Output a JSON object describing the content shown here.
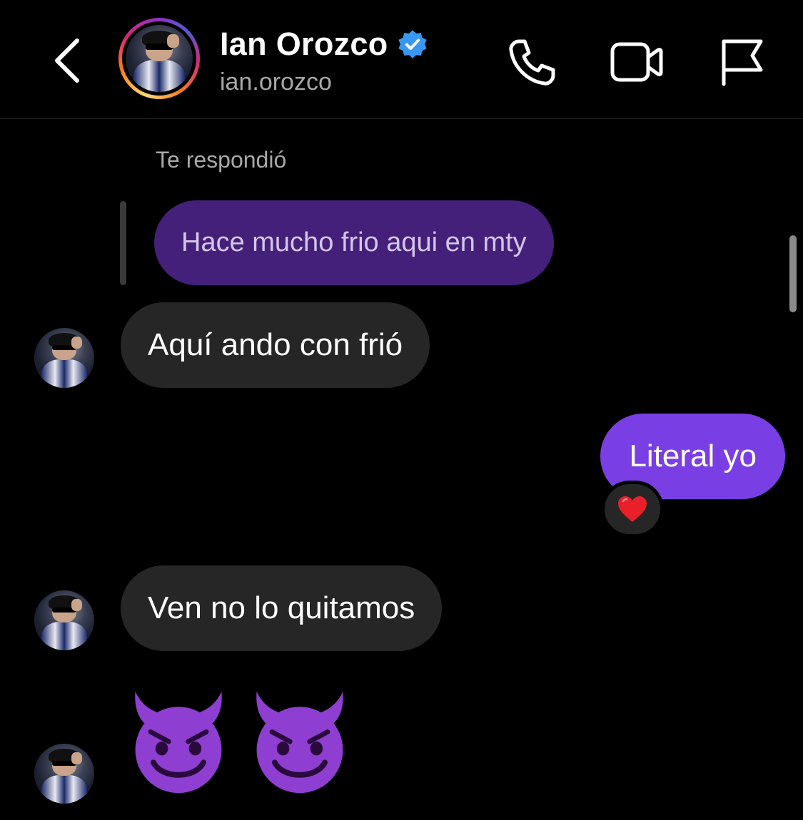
{
  "header": {
    "name": "Ian Orozco",
    "username": "ian.orozco",
    "verified": true,
    "icons": [
      "chevron-left-icon",
      "phone-icon",
      "video-camera-icon",
      "flag-icon"
    ]
  },
  "thread": {
    "replied_label": "Te respondió",
    "quoted_message": "Hace mucho frio aqui en mty",
    "messages": [
      {
        "from": "them",
        "text": "Aquí ando con frió"
      },
      {
        "from": "me",
        "text": "Literal yo",
        "reaction": "❤️"
      },
      {
        "from": "them",
        "text": "Ven no lo quitamos"
      },
      {
        "from": "them",
        "emoji": "😈😈"
      }
    ]
  },
  "colors": {
    "background": "#000000",
    "received_bubble": "#262626",
    "sent_bubble": "#7a3fe4",
    "quoted_bubble": "#44207a",
    "verified_badge": "#3897f0",
    "secondary_text": "#a8a8a8"
  }
}
